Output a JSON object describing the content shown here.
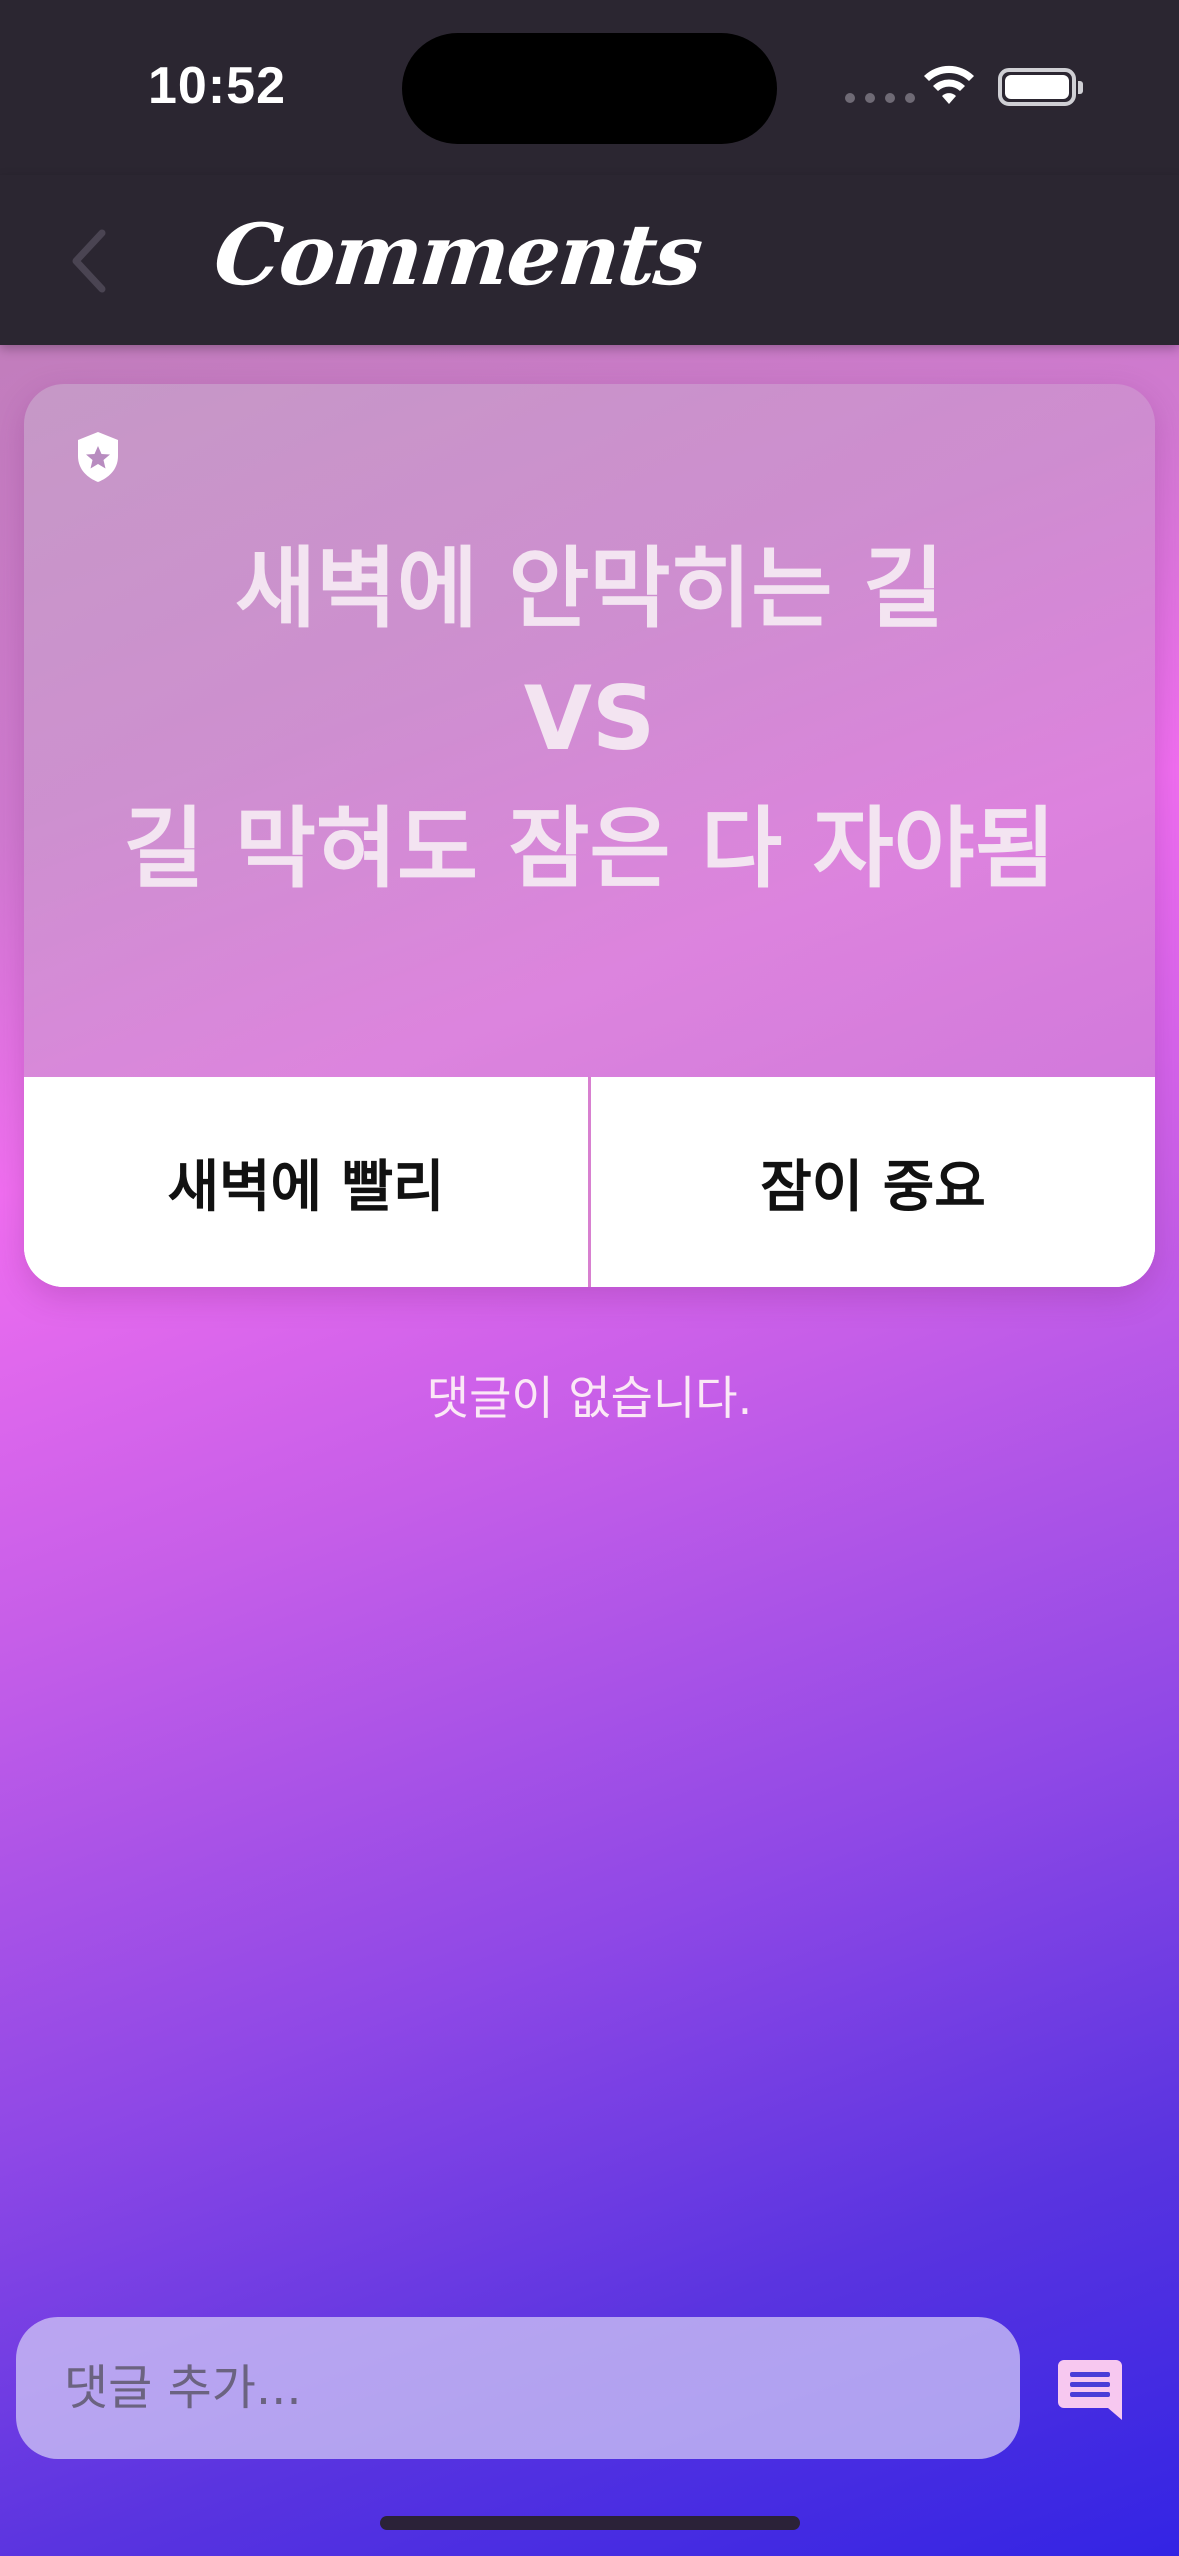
{
  "status_bar": {
    "time": "10:52",
    "icons": [
      "cellular-dots-icon",
      "wifi-icon",
      "battery-icon"
    ]
  },
  "nav": {
    "back_icon": "chevron-left-icon",
    "title": "Comments"
  },
  "question_card": {
    "badge_icon": "shield-star-icon",
    "lines": [
      "새벽에 안막히는 길",
      "VS",
      "길 막혀도 잠은 다 자야됨"
    ],
    "option_a": "새벽에 빨리",
    "option_b": "잠이 중요"
  },
  "comments": {
    "empty_message": "댓글이 없습니다."
  },
  "composer": {
    "placeholder": "댓글 추가...",
    "send_icon": "comment-send-icon"
  },
  "colors": {
    "bar_bg": "#2b2631",
    "gradient_pink": "#f06ef0",
    "gradient_blue": "#3324e4",
    "card_button_bg": "#ffffff"
  }
}
